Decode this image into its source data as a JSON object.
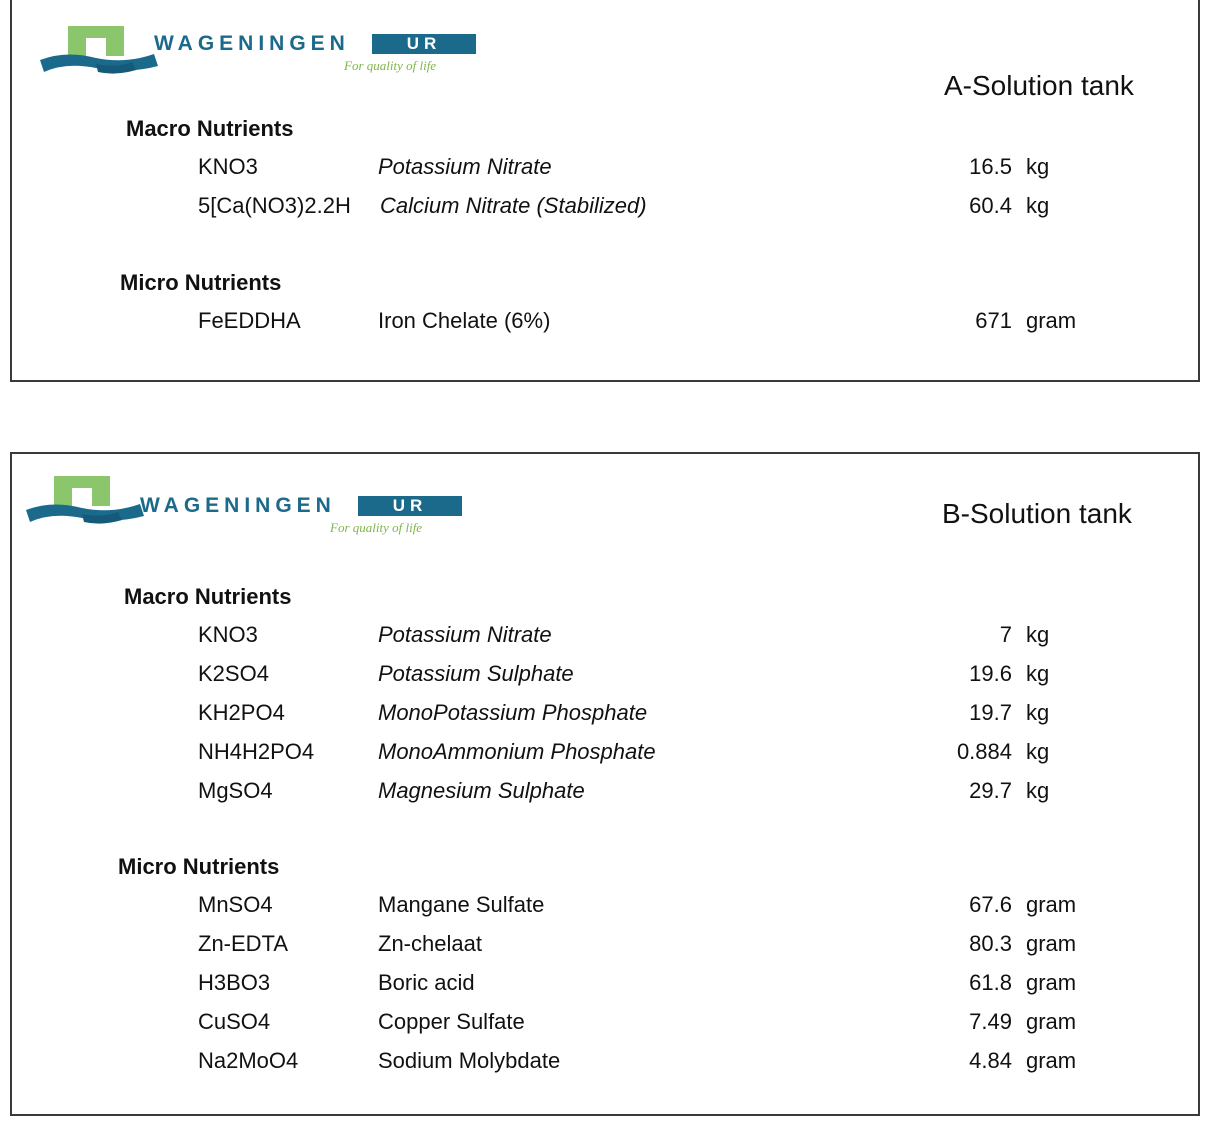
{
  "colors": {
    "logo_blue": "#1b6a8c",
    "logo_green": "#7fb54a",
    "logo_light_green": "#8cc66c",
    "border": "#3a3a3a"
  },
  "tanks": [
    {
      "title": "A-Solution tank",
      "logo": {
        "wordmark": "WAGENINGEN",
        "ur": "UR",
        "tagline": "For quality of life"
      },
      "sections": [
        {
          "title": "Macro Nutrients",
          "items": [
            {
              "formula": "KNO3",
              "name": "Potassium Nitrate",
              "amount": "16.5",
              "unit": "kg"
            },
            {
              "formula": "5[Ca(NO3)2.2H",
              "name": "Calcium Nitrate (Stabilized)",
              "amount": "60.4",
              "unit": "kg"
            }
          ]
        },
        {
          "title": "Micro Nutrients",
          "items": [
            {
              "formula": "FeEDDHA",
              "name": "Iron Chelate (6%)",
              "amount": "671",
              "unit": "gram"
            }
          ]
        }
      ]
    },
    {
      "title": "B-Solution tank",
      "logo": {
        "wordmark": "WAGENINGEN",
        "ur": "UR",
        "tagline": "For quality of life"
      },
      "sections": [
        {
          "title": "Macro Nutrients",
          "items": [
            {
              "formula": "KNO3",
              "name": "Potassium Nitrate",
              "amount": "7",
              "unit": "kg"
            },
            {
              "formula": "K2SO4",
              "name": "Potassium Sulphate",
              "amount": "19.6",
              "unit": "kg"
            },
            {
              "formula": "KH2PO4",
              "name": "MonoPotassium Phosphate",
              "amount": "19.7",
              "unit": "kg"
            },
            {
              "formula": "NH4H2PO4",
              "name": "MonoAmmonium Phosphate",
              "amount": "0.884",
              "unit": "kg"
            },
            {
              "formula": "MgSO4",
              "name": "Magnesium Sulphate",
              "amount": "29.7",
              "unit": "kg"
            }
          ]
        },
        {
          "title": "Micro Nutrients",
          "items": [
            {
              "formula": "MnSO4",
              "name": "Mangane Sulfate",
              "amount": "67.6",
              "unit": "gram"
            },
            {
              "formula": "Zn-EDTA",
              "name": "Zn-chelaat",
              "amount": "80.3",
              "unit": "gram"
            },
            {
              "formula": "H3BO3",
              "name": "Boric acid",
              "amount": "61.8",
              "unit": "gram"
            },
            {
              "formula": "CuSO4",
              "name": "Copper Sulfate",
              "amount": "7.49",
              "unit": "gram"
            },
            {
              "formula": "Na2MoO4",
              "name": "Sodium Molybdate",
              "amount": "4.84",
              "unit": "gram"
            }
          ]
        }
      ]
    }
  ]
}
